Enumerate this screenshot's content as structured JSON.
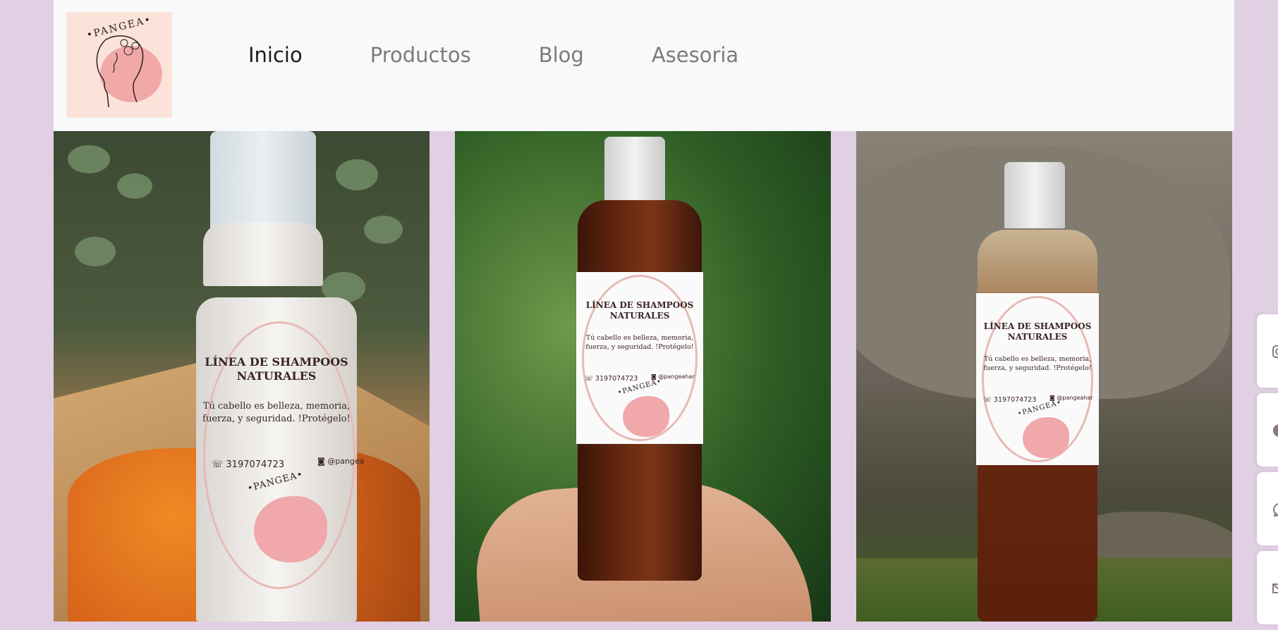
{
  "brand": {
    "logo_text": "•PANGEA•"
  },
  "nav": {
    "items": [
      {
        "label": "Inicio",
        "active": true
      },
      {
        "label": "Productos",
        "active": false
      },
      {
        "label": "Blog",
        "active": false
      },
      {
        "label": "Asesoria",
        "active": false
      }
    ]
  },
  "product_label": {
    "title_line1": "LÍNEA DE SHAMPOOS",
    "title_line2": "NATURALES",
    "body_line1": "Tú cabello es belleza, memoria,",
    "body_line2": "fuerza, y seguridad. !Protégelo!",
    "phone": "3197074723",
    "instagram": "@pangea",
    "instagram_2": "@pangeahar",
    "instagram_3": "@pangeahar",
    "brand": "•PANGEA•"
  },
  "side_actions": [
    {
      "icon": "instagram-icon"
    },
    {
      "icon": "facebook-icon"
    },
    {
      "icon": "whatsapp-icon"
    },
    {
      "icon": "mail-icon"
    }
  ],
  "colors": {
    "page_background": "#e1cfe4",
    "navbar_background": "#f8f9fb",
    "nav_active": "#1b1b1b",
    "nav_inactive": "#7b7b7b"
  }
}
